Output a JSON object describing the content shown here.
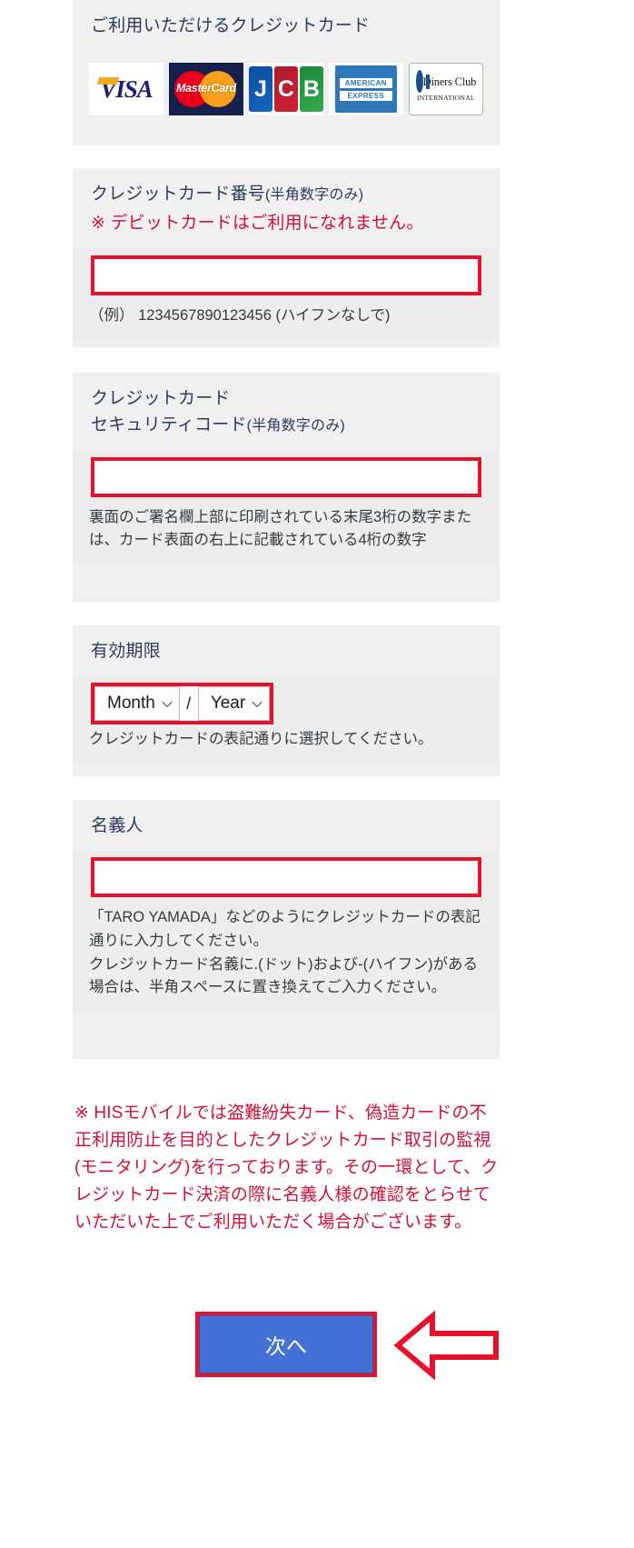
{
  "accepted_cards": {
    "heading": "ご利用いただけるクレジットカード",
    "logos": [
      {
        "name": "visa-logo",
        "text": "VISA"
      },
      {
        "name": "mastercard-logo",
        "text": "MasterCard"
      },
      {
        "name": "jcb-logo",
        "letters": [
          "J",
          "C",
          "B"
        ]
      },
      {
        "name": "amex-logo",
        "line1": "AMERICAN",
        "line2": "EXPRESS"
      },
      {
        "name": "diners-club-logo",
        "line1": "Diners Club",
        "line2": "INTERNATIONAL"
      }
    ]
  },
  "card_number": {
    "label": "クレジットカード番号",
    "label_small": "(半角数字のみ)",
    "note": "※ デビットカードはご利用になれません。",
    "value": "",
    "placeholder": "",
    "hint": "（例）  1234567890123456 (ハイフンなしで)"
  },
  "security_code": {
    "label_line1": "クレジットカード",
    "label_line2": "セキュリティコード",
    "label_small": "(半角数字のみ)",
    "value": "",
    "placeholder": "",
    "hint": "裏面のご署名欄上部に印刷されている末尾3桁の数字または、カード表面の右上に記載されている4桁の数字"
  },
  "expiry": {
    "label": "有効期限",
    "month_value": "Month",
    "separator": "/",
    "year_value": "Year",
    "hint": "クレジットカードの表記通りに選択してください。"
  },
  "cardholder": {
    "label": "名義人",
    "value": "",
    "placeholder": "",
    "hint": "「TARO YAMADA」などのようにクレジットカードの表記通りに入力してください。\nクレジットカード名義に.(ドット)および-(ハイフン)がある場合は、半角スペースに置き換えてご入力ください。"
  },
  "warning": "※ HISモバイルでは盗難紛失カード、偽造カードの不正利用防止を目的としたクレジットカード取引の監視(モニタリング)を行っております。その一環として、クレジットカード決済の際に名義人様の確認をとらせていただいた上でご利用いただく場合がございます。",
  "submit": {
    "label": "次へ"
  },
  "annotation": {
    "arrow": "left-arrow-annotation"
  },
  "colors": {
    "annotation_red": "#e8112d",
    "warning_red": "#cf1139",
    "label_navy": "#2b3a5c",
    "button_blue": "#4371d6",
    "panel_gray": "#f0f0f0"
  }
}
